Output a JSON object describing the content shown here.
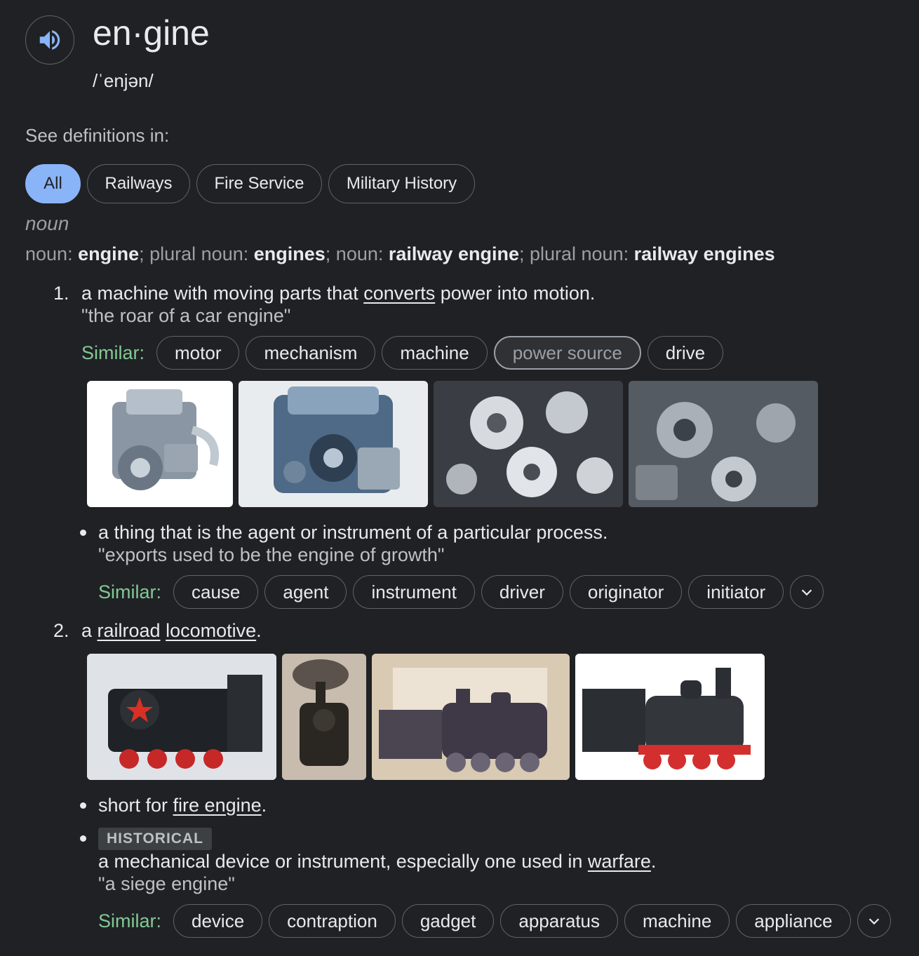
{
  "entry": {
    "word": "en·gine",
    "phonetic": "/ˈenjən/",
    "see_definitions_label": "See definitions in:",
    "categories": [
      "All",
      "Railways",
      "Fire Service",
      "Military History"
    ],
    "part_of_speech": "noun",
    "forms": [
      {
        "label": "noun",
        "word": "engine"
      },
      {
        "label": "plural noun",
        "word": "engines"
      },
      {
        "label": "noun",
        "word": "railway engine"
      },
      {
        "label": "plural noun",
        "word": "railway engines"
      }
    ]
  },
  "sense1": {
    "number": "1.",
    "def_before": "a machine with moving parts that ",
    "def_link": "converts",
    "def_after": " power into motion.",
    "example": "\"the roar of a car engine\"",
    "similar_label": "Similar:",
    "similar": [
      "motor",
      "mechanism",
      "machine",
      "power source",
      "drive"
    ],
    "images": [
      "engine-photo-1",
      "engine-photo-2",
      "engine-photo-3",
      "engine-photo-4"
    ]
  },
  "sense1b": {
    "definition": "a thing that is the agent or instrument of a particular process.",
    "example": "\"exports used to be the engine of growth\"",
    "similar_label": "Similar:",
    "similar": [
      "cause",
      "agent",
      "instrument",
      "driver",
      "originator",
      "initiator"
    ]
  },
  "sense2": {
    "number": "2.",
    "def_before": "a ",
    "link1": "railroad",
    "link2": "locomotive",
    "def_after": ".",
    "images": [
      "locomotive-photo-1",
      "locomotive-photo-2",
      "locomotive-photo-3",
      "locomotive-photo-4"
    ]
  },
  "sense2b": {
    "def_before": "short for ",
    "link": "fire engine",
    "def_after": "."
  },
  "sense2c": {
    "tag": "HISTORICAL",
    "def_before": "a mechanical device or instrument, especially one used in ",
    "link": "warfare",
    "def_after": ".",
    "example": "\"a siege engine\"",
    "similar_label": "Similar:",
    "similar": [
      "device",
      "contraption",
      "gadget",
      "apparatus",
      "machine",
      "appliance"
    ]
  },
  "colors": {
    "background": "#202124",
    "text": "#e8eaed",
    "muted": "#9aa0a6",
    "accent_blue": "#8ab4f8",
    "similar_green": "#81c995"
  }
}
